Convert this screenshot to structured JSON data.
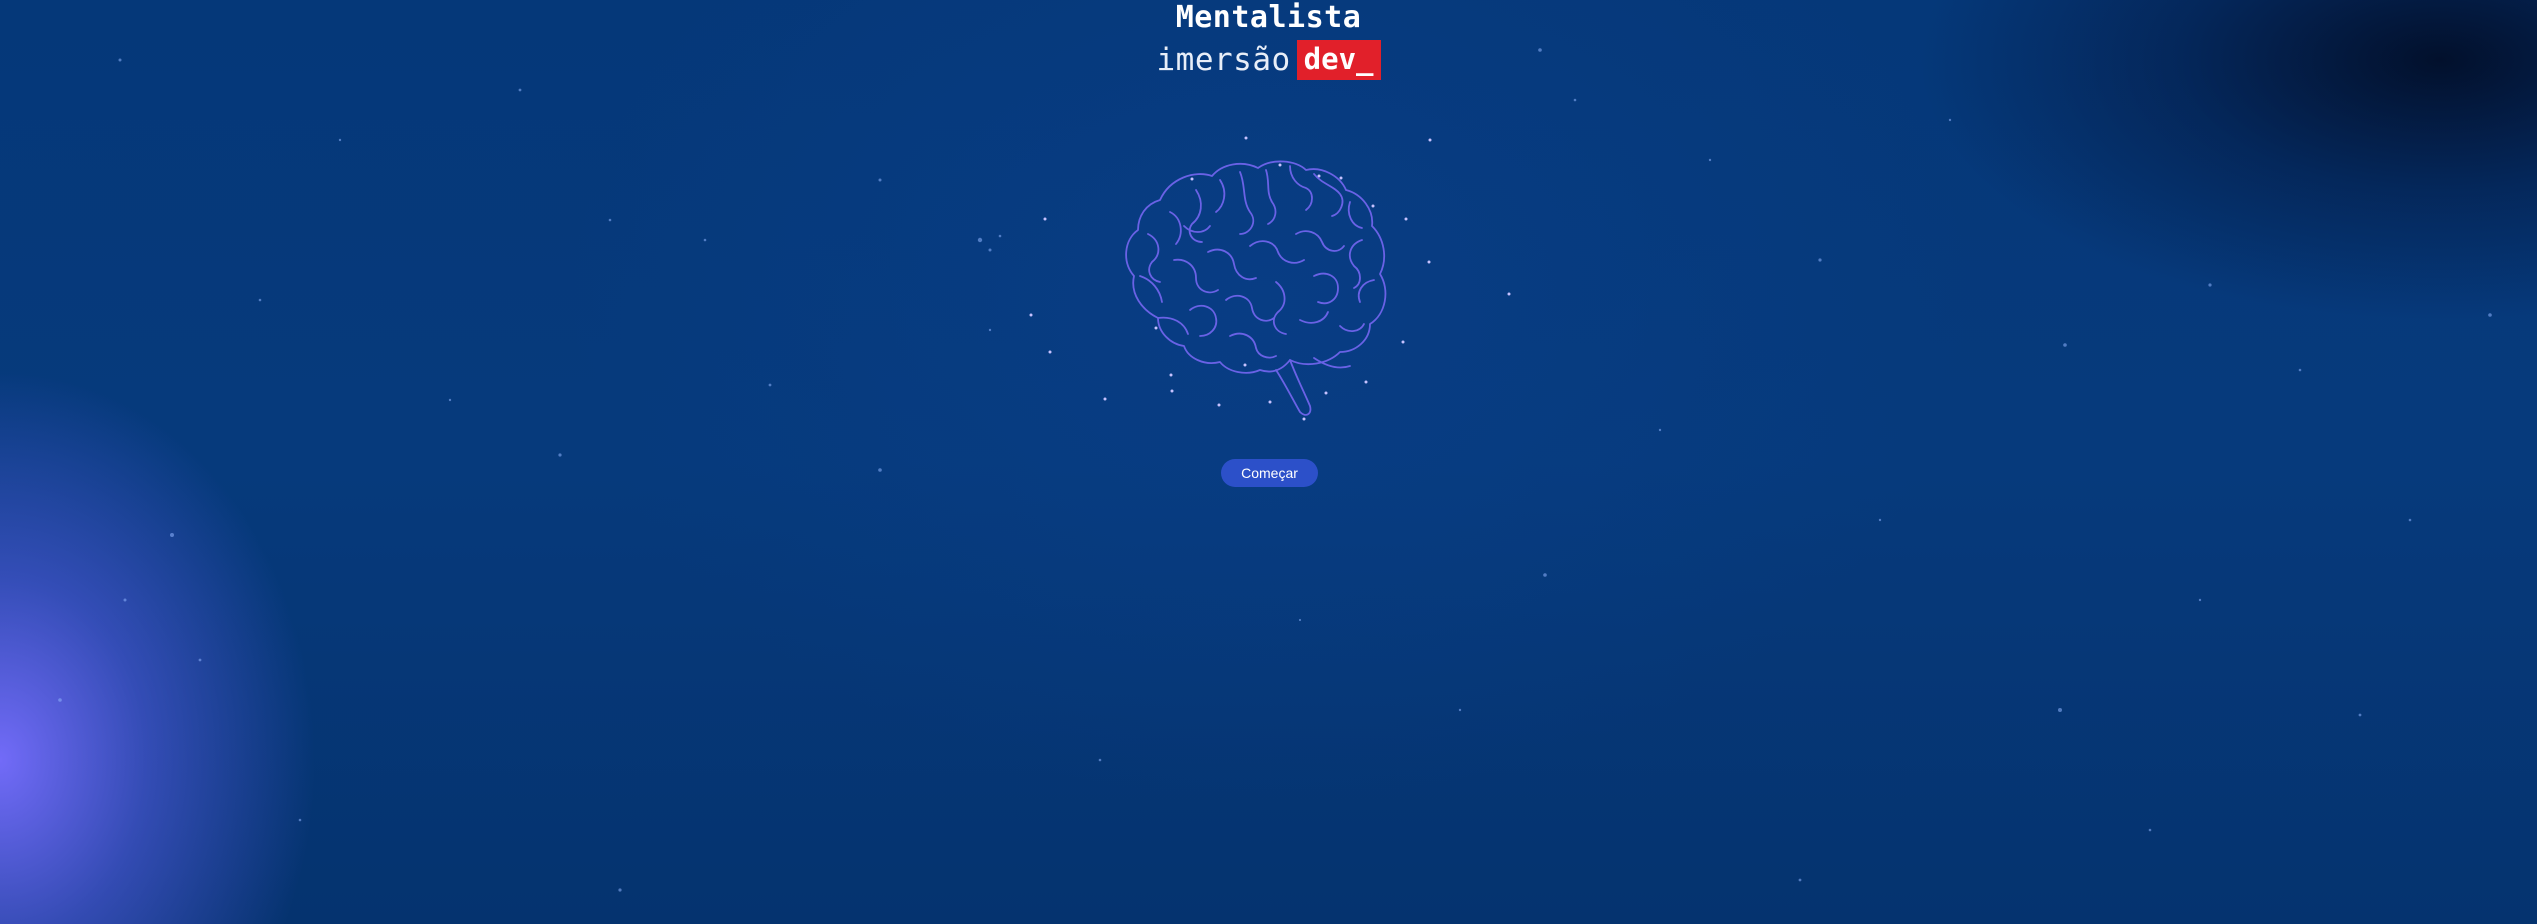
{
  "header": {
    "title": "Mentalista",
    "subtitle_prefix": "imersão",
    "badge": "dev_"
  },
  "illustration": {
    "icon": "brain-icon"
  },
  "actions": {
    "start_label": "Começar"
  },
  "colors": {
    "background": "#053879",
    "badge": "#e1202a",
    "button": "#2c50c9",
    "brain_line": "#6a62e6",
    "glow": "#7a70ff"
  }
}
